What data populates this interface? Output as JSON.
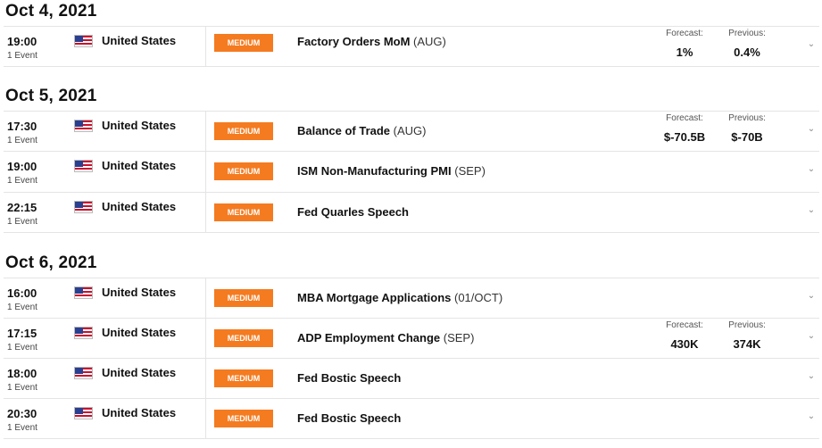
{
  "days": [
    {
      "date": "Oct 4, 2021",
      "events": [
        {
          "time": "19:00",
          "count": "1 Event",
          "country": "United States",
          "impact": "MEDIUM",
          "name": "Factory Orders MoM",
          "period": "(AUG)",
          "forecast_label": "Forecast:",
          "forecast": "1%",
          "previous_label": "Previous:",
          "previous": "0.4%"
        }
      ]
    },
    {
      "date": "Oct 5, 2021",
      "events": [
        {
          "time": "17:30",
          "count": "1 Event",
          "country": "United States",
          "impact": "MEDIUM",
          "name": "Balance of Trade",
          "period": "(AUG)",
          "forecast_label": "Forecast:",
          "forecast": "$-70.5B",
          "previous_label": "Previous:",
          "previous": "$-70B"
        },
        {
          "time": "19:00",
          "count": "1 Event",
          "country": "United States",
          "impact": "MEDIUM",
          "name": "ISM Non-Manufacturing PMI",
          "period": "(SEP)"
        },
        {
          "time": "22:15",
          "count": "1 Event",
          "country": "United States",
          "impact": "MEDIUM",
          "name": "Fed Quarles Speech",
          "period": ""
        }
      ]
    },
    {
      "date": "Oct 6, 2021",
      "events": [
        {
          "time": "16:00",
          "count": "1 Event",
          "country": "United States",
          "impact": "MEDIUM",
          "name": "MBA Mortgage Applications",
          "period": "(01/OCT)"
        },
        {
          "time": "17:15",
          "count": "1 Event",
          "country": "United States",
          "impact": "MEDIUM",
          "name": "ADP Employment Change",
          "period": "(SEP)",
          "forecast_label": "Forecast:",
          "forecast": "430K",
          "previous_label": "Previous:",
          "previous": "374K"
        },
        {
          "time": "18:00",
          "count": "1 Event",
          "country": "United States",
          "impact": "MEDIUM",
          "name": "Fed Bostic Speech",
          "period": ""
        },
        {
          "time": "20:30",
          "count": "1 Event",
          "country": "United States",
          "impact": "MEDIUM",
          "name": "Fed Bostic Speech",
          "period": ""
        }
      ]
    }
  ],
  "colors": {
    "impact_medium": "#f47b20",
    "flag_red": "#c8102e",
    "flag_blue": "#2a3f8f"
  },
  "icons": {
    "flag": "us-flag-icon",
    "expand": "chevron-down-icon"
  }
}
